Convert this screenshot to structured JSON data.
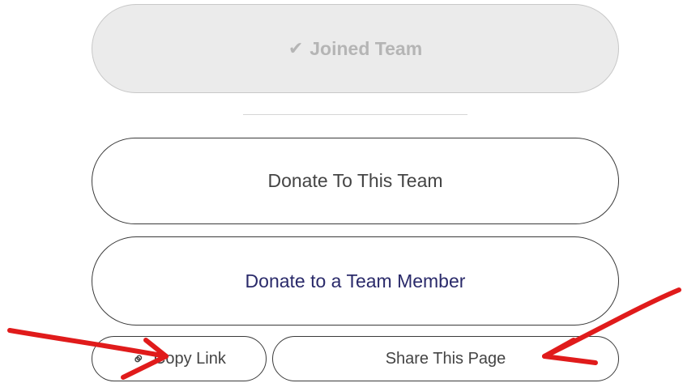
{
  "buttons": {
    "joined_team": {
      "icon": "checkmark-icon",
      "label": "Joined Team"
    },
    "donate_team": {
      "label": "Donate To This Team"
    },
    "donate_member": {
      "label": "Donate to a Team Member"
    },
    "copy_link": {
      "icon": "link-icon",
      "label": "Copy Link"
    },
    "share_page": {
      "label": "Share This Page"
    }
  },
  "colors": {
    "joined_bg": "#ebebeb",
    "joined_text": "#b5b5b5",
    "member_text": "#2a2a6a",
    "annotation": "#e01b1b"
  }
}
